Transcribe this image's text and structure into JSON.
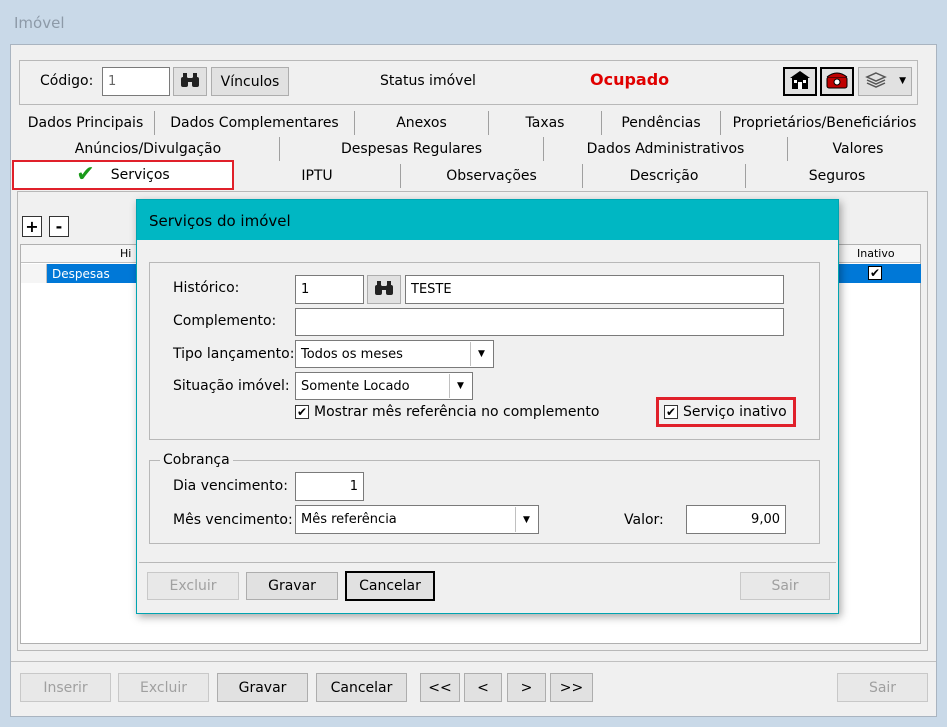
{
  "window": {
    "title": "Imóvel"
  },
  "header": {
    "codigo_label": "Código:",
    "codigo_value": "1",
    "vinculos_label": "Vínculos",
    "status_label": "Status imóvel",
    "status_value": "Ocupado",
    "status_color": "#e00000"
  },
  "tabs": {
    "row1": [
      "Dados Principais",
      "Dados Complementares",
      "Anexos",
      "Taxas",
      "Pendências",
      "Proprietários/Beneficiários"
    ],
    "row2": [
      "Anúncios/Divulgação",
      "Despesas Regulares",
      "Dados Administrativos",
      "Valores"
    ],
    "row3": [
      "Serviços",
      "IPTU",
      "Observações",
      "Descrição",
      "Seguros"
    ],
    "active": "Serviços"
  },
  "grid": {
    "add": "+",
    "remove": "-",
    "col_historico": "Hi",
    "col_inativo": "Inativo",
    "row_text": "Despesas",
    "selected_color": "#0078d7"
  },
  "modal": {
    "title": "Serviços do imóvel",
    "title_bg": "#00b7c3",
    "historico_label": "Histórico:",
    "historico_code": "1",
    "historico_desc": "TESTE",
    "complemento_label": "Complemento:",
    "complemento_value": "",
    "tipo_label": "Tipo lançamento:",
    "tipo_value": "Todos os meses",
    "situacao_label": "Situação imóvel:",
    "situacao_value": "Somente Locado",
    "mostrar_mes_label": "Mostrar mês referência no complemento",
    "servico_inativo_label": "Serviço inativo",
    "cobranca_legend": "Cobrança",
    "dia_label": "Dia vencimento:",
    "dia_value": "1",
    "mes_label": "Mês vencimento:",
    "mes_value": "Mês referência",
    "valor_label": "Valor:",
    "valor_value": "9,00",
    "btn_excluir": "Excluir",
    "btn_gravar": "Gravar",
    "btn_cancelar": "Cancelar",
    "btn_sair": "Sair"
  },
  "footer": {
    "inserir": "Inserir",
    "excluir": "Excluir",
    "gravar": "Gravar",
    "cancelar": "Cancelar",
    "first": "<<",
    "prev": "<",
    "next": ">",
    "last": ">>",
    "sair": "Sair"
  },
  "highlight_color": "#e0202a"
}
